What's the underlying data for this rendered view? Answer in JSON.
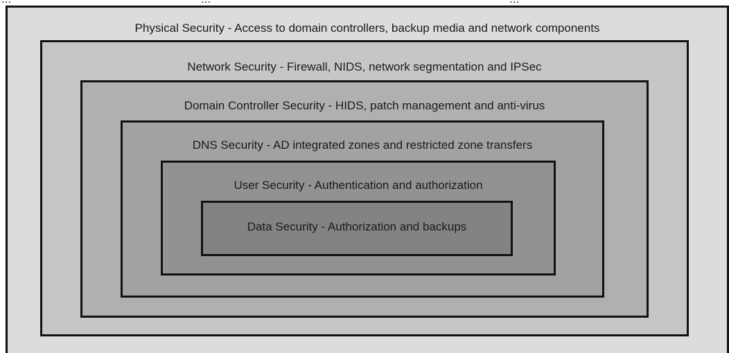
{
  "top_fragment": {
    "left": "...",
    "middle": "...",
    "right": "..."
  },
  "layers": [
    {
      "label": "Physical Security - Access to domain controllers, backup media and network components",
      "fill": "#dcdcdc"
    },
    {
      "label": "Network Security - Firewall, NIDS, network segmentation and IPSec",
      "fill": "#c6c6c6"
    },
    {
      "label": "Domain Controller Security - HIDS, patch management and anti-virus",
      "fill": "#b0b0b0"
    },
    {
      "label": "DNS Security - AD integrated zones and restricted zone transfers",
      "fill": "#a2a2a2"
    },
    {
      "label": "User Security - Authentication and authorization",
      "fill": "#929292"
    },
    {
      "label": "Data Security - Authorization and backups",
      "fill": "#838383"
    }
  ]
}
